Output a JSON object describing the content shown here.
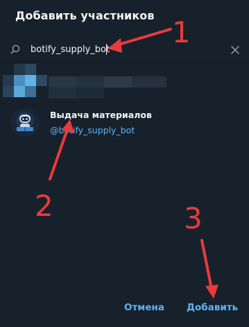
{
  "dialog": {
    "title": "Добавить участников"
  },
  "search": {
    "value": "botify_supply_bot"
  },
  "contact": {
    "name": "Выдача материалов",
    "username": "@botify_supply_bot"
  },
  "buttons": {
    "cancel_label": "Отмена",
    "add_label": "Добавить"
  },
  "annotations": {
    "markers": [
      "1",
      "2",
      "3"
    ],
    "color": "#ea3b3b"
  },
  "colors": {
    "background": "#17212b",
    "accent": "#5eb5f7",
    "text": "#f5f5f5"
  }
}
